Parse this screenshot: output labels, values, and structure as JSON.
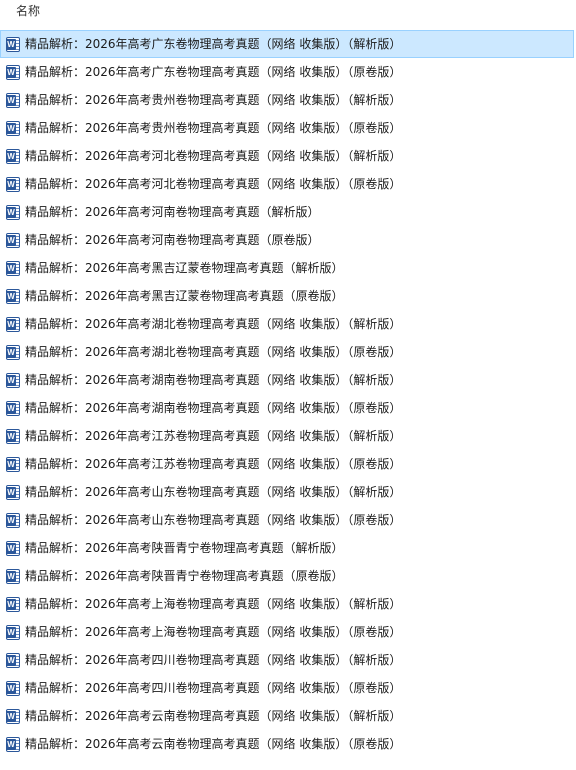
{
  "header": {
    "column_name": "名称",
    "sort_indicator": "^"
  },
  "icon": {
    "type": "word-document-icon",
    "letter": "W",
    "color": "#2b579a"
  },
  "selected_index": 0,
  "files": [
    "精品解析：2026年高考广东卷物理高考真题（网络 收集版）（解析版）",
    "精品解析：2026年高考广东卷物理高考真题（网络 收集版）（原卷版）",
    "精品解析：2026年高考贵州卷物理高考真题（网络 收集版）（解析版）",
    "精品解析：2026年高考贵州卷物理高考真题（网络 收集版）（原卷版）",
    "精品解析：2026年高考河北卷物理高考真题（网络 收集版）（解析版）",
    "精品解析：2026年高考河北卷物理高考真题（网络 收集版）（原卷版）",
    "精品解析：2026年高考河南卷物理高考真题（解析版）",
    "精品解析：2026年高考河南卷物理高考真题（原卷版）",
    "精品解析：2026年高考黑吉辽蒙卷物理高考真题（解析版）",
    "精品解析：2026年高考黑吉辽蒙卷物理高考真题（原卷版）",
    "精品解析：2026年高考湖北卷物理高考真题（网络 收集版）（解析版）",
    "精品解析：2026年高考湖北卷物理高考真题（网络 收集版）（原卷版）",
    "精品解析：2026年高考湖南卷物理高考真题（网络 收集版）（解析版）",
    "精品解析：2026年高考湖南卷物理高考真题（网络 收集版）（原卷版）",
    "精品解析：2026年高考江苏卷物理高考真题（网络 收集版）（解析版）",
    "精品解析：2026年高考江苏卷物理高考真题（网络 收集版）（原卷版）",
    "精品解析：2026年高考山东卷物理高考真题（网络 收集版）（解析版）",
    "精品解析：2026年高考山东卷物理高考真题（网络 收集版）（原卷版）",
    "精品解析：2026年高考陕晋青宁卷物理高考真题（解析版）",
    "精品解析：2026年高考陕晋青宁卷物理高考真题（原卷版）",
    "精品解析：2026年高考上海卷物理高考真题（网络 收集版）（解析版）",
    "精品解析：2026年高考上海卷物理高考真题（网络 收集版）（原卷版）",
    "精品解析：2026年高考四川卷物理高考真题（网络 收集版）（解析版）",
    "精品解析：2026年高考四川卷物理高考真题（网络 收集版）（原卷版）",
    "精品解析：2026年高考云南卷物理高考真题（网络 收集版）（解析版）",
    "精品解析：2026年高考云南卷物理高考真题（网络 收集版）（原卷版）"
  ]
}
